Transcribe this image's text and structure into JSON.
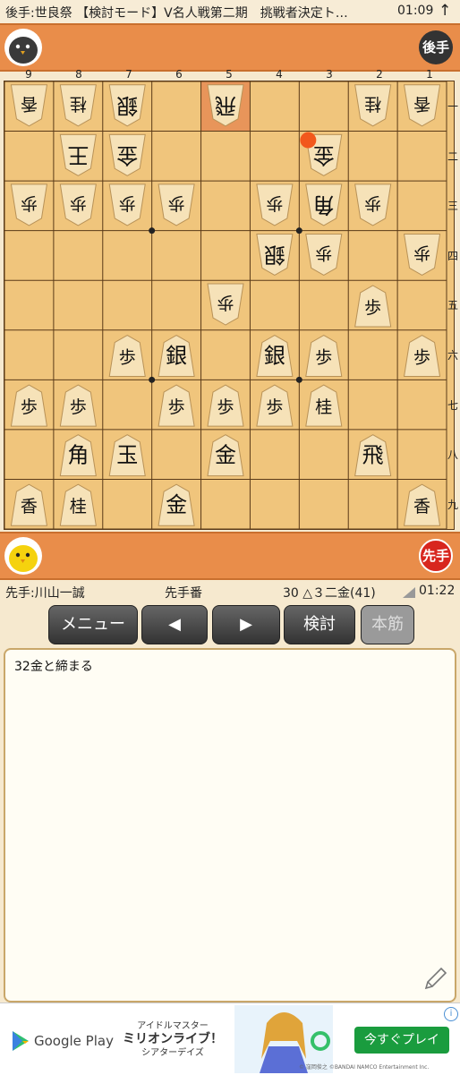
{
  "header": {
    "title": "後手:世良祭 【検討モード】V名人戦第二期　挑戦者決定ト…",
    "clock": "01:09",
    "arrow": "↑"
  },
  "gote": {
    "badge": "後手",
    "badge_color": "#333333"
  },
  "sente": {
    "badge": "先手",
    "badge_color": "#d8261e"
  },
  "files": [
    "9",
    "8",
    "7",
    "6",
    "5",
    "4",
    "3",
    "2",
    "1"
  ],
  "ranks": [
    "一",
    "二",
    "三",
    "四",
    "五",
    "六",
    "七",
    "八",
    "九"
  ],
  "board": {
    "highlight": [
      4,
      0
    ],
    "marker": [
      6,
      1
    ],
    "marker_color": "#f2581c",
    "pieces": [
      {
        "c": 0,
        "r": 0,
        "k": "香",
        "g": true
      },
      {
        "c": 1,
        "r": 0,
        "k": "桂",
        "g": true
      },
      {
        "c": 2,
        "r": 0,
        "k": "銀",
        "g": true
      },
      {
        "c": 4,
        "r": 0,
        "k": "飛",
        "g": true
      },
      {
        "c": 7,
        "r": 0,
        "k": "桂",
        "g": true
      },
      {
        "c": 8,
        "r": 0,
        "k": "香",
        "g": true
      },
      {
        "c": 1,
        "r": 1,
        "k": "王",
        "g": true
      },
      {
        "c": 2,
        "r": 1,
        "k": "金",
        "g": true
      },
      {
        "c": 6,
        "r": 1,
        "k": "金",
        "g": true
      },
      {
        "c": 0,
        "r": 2,
        "k": "歩",
        "g": true
      },
      {
        "c": 1,
        "r": 2,
        "k": "歩",
        "g": true
      },
      {
        "c": 2,
        "r": 2,
        "k": "歩",
        "g": true
      },
      {
        "c": 3,
        "r": 2,
        "k": "歩",
        "g": true
      },
      {
        "c": 5,
        "r": 2,
        "k": "歩",
        "g": true
      },
      {
        "c": 6,
        "r": 2,
        "k": "角",
        "g": true
      },
      {
        "c": 7,
        "r": 2,
        "k": "歩",
        "g": true
      },
      {
        "c": 5,
        "r": 3,
        "k": "銀",
        "g": true
      },
      {
        "c": 6,
        "r": 3,
        "k": "歩",
        "g": true
      },
      {
        "c": 8,
        "r": 3,
        "k": "歩",
        "g": true
      },
      {
        "c": 4,
        "r": 4,
        "k": "歩",
        "g": true
      },
      {
        "c": 7,
        "r": 4,
        "k": "歩",
        "g": false
      },
      {
        "c": 2,
        "r": 5,
        "k": "歩",
        "g": false
      },
      {
        "c": 3,
        "r": 5,
        "k": "銀",
        "g": false
      },
      {
        "c": 5,
        "r": 5,
        "k": "銀",
        "g": false
      },
      {
        "c": 6,
        "r": 5,
        "k": "歩",
        "g": false
      },
      {
        "c": 8,
        "r": 5,
        "k": "歩",
        "g": false
      },
      {
        "c": 0,
        "r": 6,
        "k": "歩",
        "g": false
      },
      {
        "c": 1,
        "r": 6,
        "k": "歩",
        "g": false
      },
      {
        "c": 3,
        "r": 6,
        "k": "歩",
        "g": false
      },
      {
        "c": 4,
        "r": 6,
        "k": "歩",
        "g": false
      },
      {
        "c": 5,
        "r": 6,
        "k": "歩",
        "g": false
      },
      {
        "c": 6,
        "r": 6,
        "k": "桂",
        "g": false
      },
      {
        "c": 1,
        "r": 7,
        "k": "角",
        "g": false
      },
      {
        "c": 2,
        "r": 7,
        "k": "玉",
        "g": false
      },
      {
        "c": 4,
        "r": 7,
        "k": "金",
        "g": false
      },
      {
        "c": 7,
        "r": 7,
        "k": "飛",
        "g": false
      },
      {
        "c": 0,
        "r": 8,
        "k": "香",
        "g": false
      },
      {
        "c": 1,
        "r": 8,
        "k": "桂",
        "g": false
      },
      {
        "c": 3,
        "r": 8,
        "k": "金",
        "g": false
      },
      {
        "c": 8,
        "r": 8,
        "k": "香",
        "g": false
      }
    ]
  },
  "info": {
    "player": "先手:川山一誠",
    "turn": "先手番",
    "move": "30 △３二金(41)",
    "time": "01:22"
  },
  "buttons": {
    "menu": "メニュー",
    "prev": "◀",
    "next": "▶",
    "analyze": "検討",
    "mainline": "本筋"
  },
  "comment": {
    "text": "32金と締まる"
  },
  "ad": {
    "store": "Google Play",
    "game_line1": "アイドルマスター",
    "game_line2": "ミリオンライブ！",
    "game_line3": "シアターデイズ",
    "cta": "今すぐプレイ",
    "copyright": "© 窪岡俊之 ©BANDAI NAMCO Entertainment Inc.",
    "info_icon": "i"
  },
  "colors": {
    "stand": "#e98d4a",
    "board": "#f0c57c",
    "highlight": "#e8955a",
    "piece": "#f6e2b8"
  }
}
